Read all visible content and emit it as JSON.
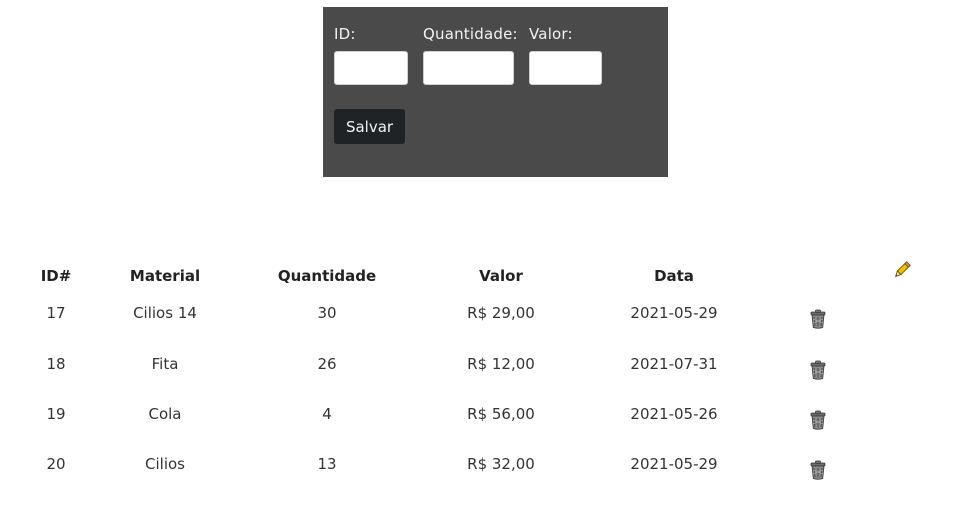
{
  "form": {
    "id_label": "ID:",
    "quantidade_label": "Quantidade:",
    "valor_label": "Valor:",
    "id_value": "",
    "quantidade_value": "",
    "valor_value": "",
    "save_label": "Salvar"
  },
  "table": {
    "headers": {
      "id": "ID#",
      "material": "Material",
      "quantidade": "Quantidade",
      "valor": "Valor",
      "data": "Data"
    },
    "header_icon": "pencil-icon",
    "row_icon": "trash-icon",
    "rows": [
      {
        "id": "17",
        "material": "Cilios 14",
        "quantidade": "30",
        "valor": "R$ 29,00",
        "data": "2021-05-29"
      },
      {
        "id": "18",
        "material": "Fita",
        "quantidade": "26",
        "valor": "R$ 12,00",
        "data": "2021-07-31"
      },
      {
        "id": "19",
        "material": "Cola",
        "quantidade": "4",
        "valor": "R$ 56,00",
        "data": "2021-05-26"
      },
      {
        "id": "20",
        "material": "Cilios",
        "quantidade": "13",
        "valor": "R$ 32,00",
        "data": "2021-05-29"
      }
    ]
  },
  "colors": {
    "panel_bg": "#4a4a4a",
    "button_bg": "#1f2326",
    "pencil": "#f2c200"
  }
}
